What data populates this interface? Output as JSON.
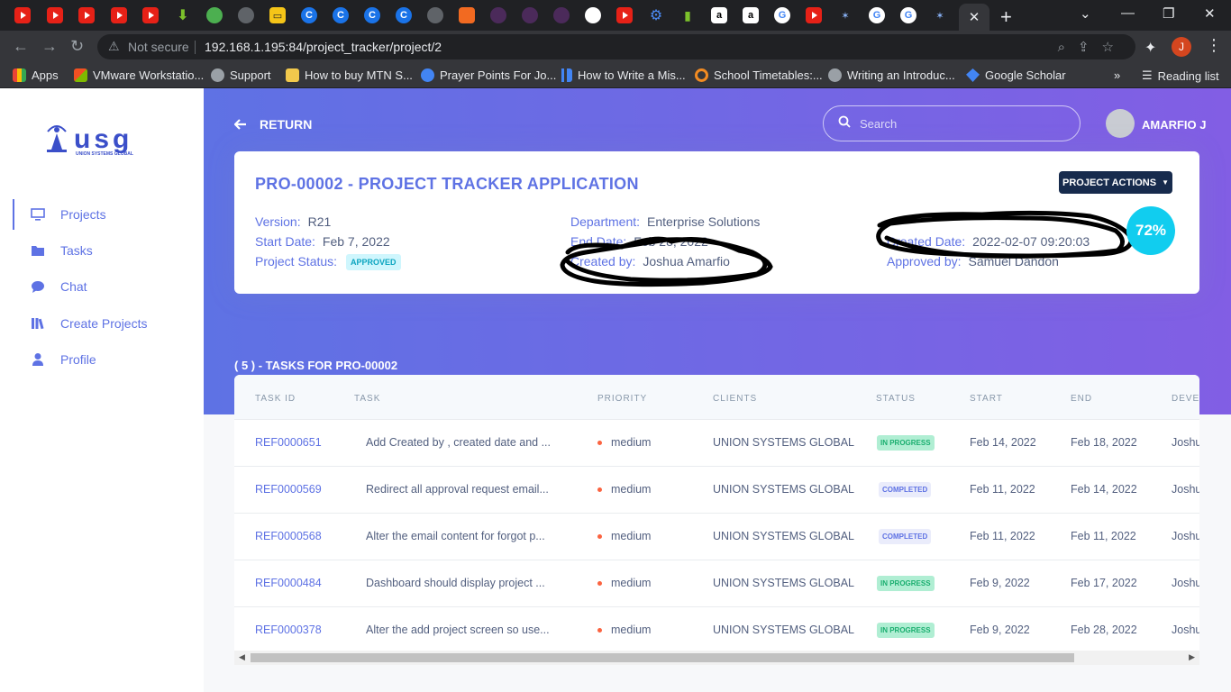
{
  "browser": {
    "url_warning": "Not secure",
    "url": "192.168.1.195:84/project_tracker/project/2",
    "profile_initial": "J",
    "bookmarks": [
      "Apps",
      "VMware Workstatio...",
      "Support",
      "How to buy MTN S...",
      "Prayer Points For Jo...",
      "How to Write a Mis...",
      "School Timetables:...",
      "Writing an Introduc...",
      "Google Scholar"
    ],
    "reading_list": "Reading list"
  },
  "sidebar": {
    "logo_text": "usg",
    "logo_subtext": "UNION SYSTEMS GLOBAL",
    "items": [
      {
        "label": "Projects",
        "icon": "monitor-icon"
      },
      {
        "label": "Tasks",
        "icon": "folder-icon"
      },
      {
        "label": "Chat",
        "icon": "chat-icon"
      },
      {
        "label": "Create Projects",
        "icon": "books-icon"
      },
      {
        "label": "Profile",
        "icon": "user-icon"
      }
    ]
  },
  "header": {
    "return_label": "RETURN",
    "search_placeholder": "Search",
    "user_name": "AMARFIO J"
  },
  "project": {
    "title": "PRO-00002 - PROJECT TRACKER APPLICATION",
    "actions_label": "PROJECT ACTIONS",
    "version_label": "Version:",
    "version": "R21",
    "start_label": "Start Date:",
    "start": "Feb 7, 2022",
    "status_label": "Project Status:",
    "status": "APPROVED",
    "department_label": "Department:",
    "department": "Enterprise Solutions",
    "end_label": "End Date:",
    "end": "Feb 28, 2022",
    "created_by_label": "Created by:",
    "created_by": "Joshua Amarfio",
    "created_date_label": "Created Date:",
    "created_date": "2022-02-07 09:20:03",
    "approved_by_label": "Approved by:",
    "approved_by": "Samuel Dandon",
    "progress": "72%"
  },
  "tasks": {
    "title": "( 5 ) - TASKS FOR PRO-00002",
    "columns": [
      "TASK ID",
      "TASK",
      "PRIORITY",
      "CLIENTS",
      "STATUS",
      "START",
      "END",
      "DEVEL"
    ],
    "rows": [
      {
        "id": "REF0000651",
        "task": "Add Created by , created date and ...",
        "priority": "medium",
        "client": "UNION SYSTEMS GLOBAL",
        "status": "IN PROGRESS",
        "start": "Feb 14, 2022",
        "end": "Feb 18, 2022",
        "dev": "Joshu"
      },
      {
        "id": "REF0000569",
        "task": "Redirect all approval request email...",
        "priority": "medium",
        "client": "UNION SYSTEMS GLOBAL",
        "status": "COMPLETED",
        "start": "Feb 11, 2022",
        "end": "Feb 14, 2022",
        "dev": "Joshu"
      },
      {
        "id": "REF0000568",
        "task": "Alter the email content for forgot p...",
        "priority": "medium",
        "client": "UNION SYSTEMS GLOBAL",
        "status": "COMPLETED",
        "start": "Feb 11, 2022",
        "end": "Feb 11, 2022",
        "dev": "Joshu"
      },
      {
        "id": "REF0000484",
        "task": "Dashboard should display project ...",
        "priority": "medium",
        "client": "UNION SYSTEMS GLOBAL",
        "status": "IN PROGRESS",
        "start": "Feb 9, 2022",
        "end": "Feb 17, 2022",
        "dev": "Joshu"
      },
      {
        "id": "REF0000378",
        "task": "Alter the add project screen so use...",
        "priority": "medium",
        "client": "UNION SYSTEMS GLOBAL",
        "status": "IN PROGRESS",
        "start": "Feb 9, 2022",
        "end": "Feb 28, 2022",
        "dev": "Joshu"
      }
    ]
  },
  "colors": {
    "primary": "#5e72e4",
    "gradient_end": "#825ee4",
    "info": "#11cdef",
    "dark": "#172b4d"
  }
}
